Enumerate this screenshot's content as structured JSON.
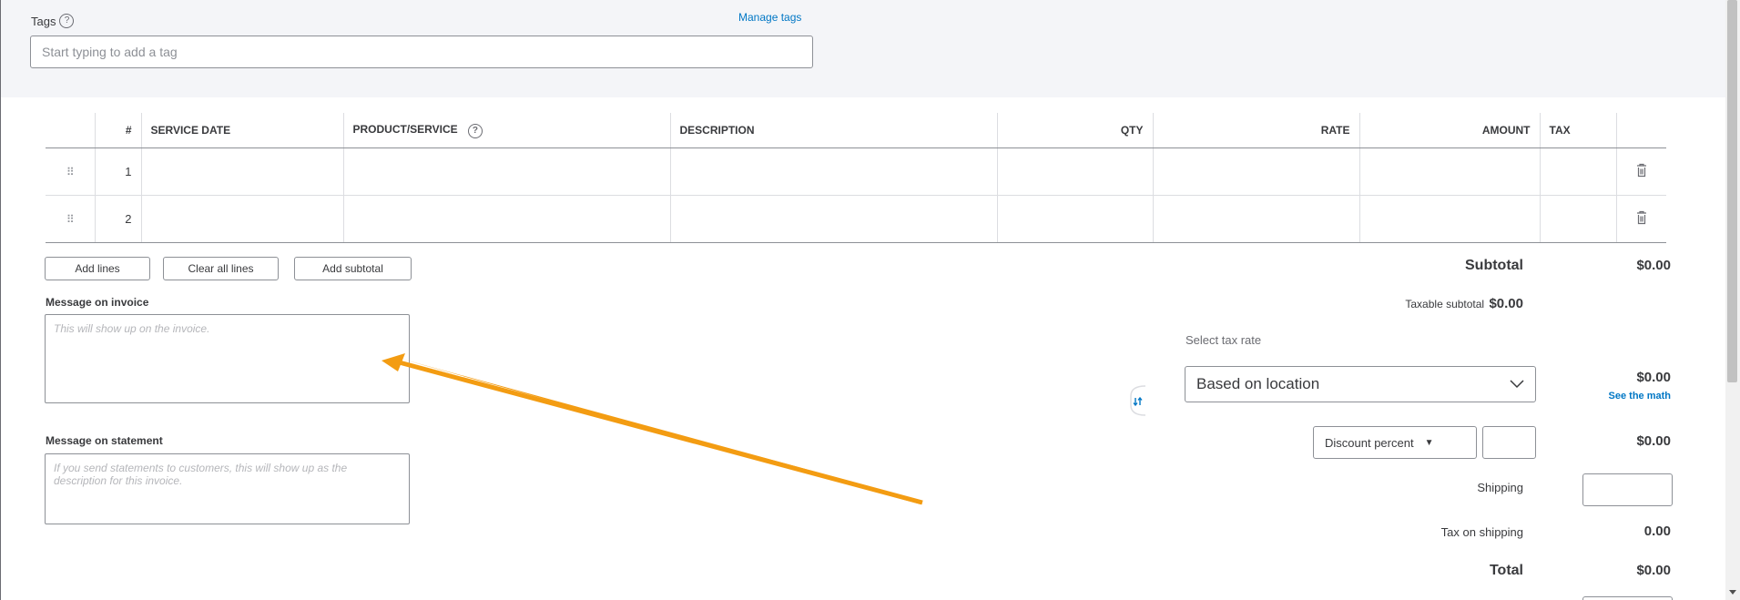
{
  "tags": {
    "label": "Tags",
    "help_icon": "question-circle-icon",
    "manage_link": "Manage tags",
    "input_placeholder": "Start typing to add a tag"
  },
  "table": {
    "headers": [
      "#",
      "SERVICE DATE",
      "PRODUCT/SERVICE",
      "DESCRIPTION",
      "QTY",
      "RATE",
      "AMOUNT",
      "TAX"
    ],
    "rows": [
      {
        "num": "1"
      },
      {
        "num": "2"
      }
    ]
  },
  "buttons": {
    "add_lines": "Add lines",
    "clear_all_lines": "Clear all lines",
    "add_subtotal": "Add subtotal"
  },
  "messages": {
    "invoice_label": "Message on invoice",
    "invoice_placeholder": "This will show up on the invoice.",
    "statement_label": "Message on statement",
    "statement_placeholder": "If you send statements to customers, this will show up as the description for this invoice."
  },
  "totals": {
    "subtotal_label": "Subtotal",
    "subtotal_value": "$0.00",
    "taxable_subtotal_label": "Taxable subtotal",
    "taxable_subtotal_value": "$0.00",
    "select_tax_rate_label": "Select tax rate",
    "tax_rate_selected": "Based on location",
    "tax_value": "$0.00",
    "see_the_math": "See the math",
    "discount_type": "Discount percent",
    "discount_value": "$0.00",
    "shipping_label": "Shipping",
    "tax_on_shipping_label": "Tax on shipping",
    "tax_on_shipping_value": "0.00",
    "total_label": "Total",
    "total_value": "$0.00"
  },
  "colors": {
    "link": "#0077c5",
    "annotation_arrow": "#f39c12"
  }
}
